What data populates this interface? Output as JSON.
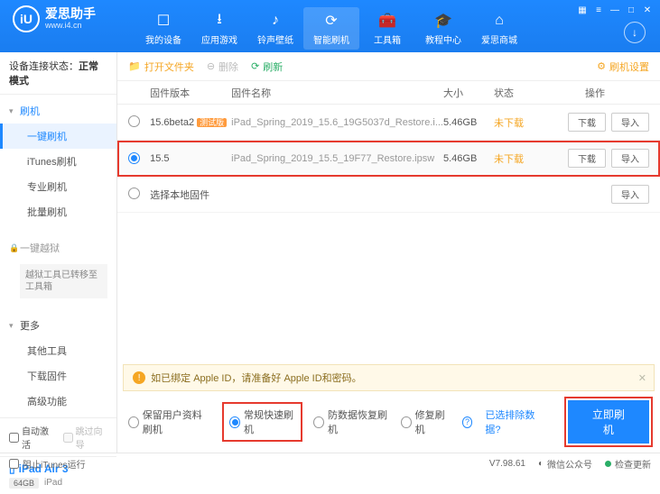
{
  "brand": {
    "title": "爱思助手",
    "sub": "www.i4.cn",
    "logo_letter": "iU"
  },
  "titlebar": {
    "menu": "▦",
    "tray": "≡",
    "min": "—",
    "max": "□",
    "close": "✕"
  },
  "nav": [
    {
      "icon": "☐",
      "label": "我的设备"
    },
    {
      "icon": "⭳",
      "label": "应用游戏"
    },
    {
      "icon": "♪",
      "label": "铃声壁纸"
    },
    {
      "icon": "⟳",
      "label": "智能刷机"
    },
    {
      "icon": "🧰",
      "label": "工具箱"
    },
    {
      "icon": "🎓",
      "label": "教程中心"
    },
    {
      "icon": "⌂",
      "label": "爱思商城"
    }
  ],
  "header_right_icon": "↓",
  "sidebar": {
    "conn_label": "设备连接状态：",
    "conn_value": "正常模式",
    "sections": {
      "flash": {
        "head": "刷机",
        "items": [
          "一键刷机",
          "iTunes刷机",
          "专业刷机",
          "批量刷机"
        ]
      },
      "jailbreak": {
        "head": "一键越狱",
        "note": "越狱工具已转移至工具箱"
      },
      "more": {
        "head": "更多",
        "items": [
          "其他工具",
          "下载固件",
          "高级功能"
        ]
      }
    },
    "checks": {
      "auto_activate": "自动激活",
      "skip_guide": "跳过向导"
    },
    "device": {
      "name": "iPad Air 3",
      "storage": "64GB",
      "type": "iPad"
    }
  },
  "toolbar": {
    "open_folder": "打开文件夹",
    "delete": "删除",
    "refresh": "刷新",
    "settings": "刷机设置"
  },
  "table": {
    "headers": {
      "ver": "固件版本",
      "name": "固件名称",
      "size": "大小",
      "status": "状态",
      "ops": "操作"
    },
    "rows": [
      {
        "ver": "15.6beta2",
        "beta": "测试版",
        "name": "iPad_Spring_2019_15.6_19G5037d_Restore.i...",
        "size": "5.46GB",
        "status": "未下载",
        "selected": false
      },
      {
        "ver": "15.5",
        "beta": "",
        "name": "iPad_Spring_2019_15.5_19F77_Restore.ipsw",
        "size": "5.46GB",
        "status": "未下载",
        "selected": true
      }
    ],
    "local_row": "选择本地固件",
    "btn_download": "下载",
    "btn_import": "导入"
  },
  "alert": {
    "text": "如已绑定 Apple ID，请准备好 Apple ID和密码。"
  },
  "options": {
    "keep_data": "保留用户资料刷机",
    "normal": "常规快速刷机",
    "anti_recovery": "防数据恢复刷机",
    "repair": "修复刷机",
    "exclude_link": "已选排除数据?",
    "flash_btn": "立即刷机"
  },
  "footer": {
    "block_itunes": "阻止iTunes运行",
    "version": "V7.98.61",
    "wechat": "微信公众号",
    "check_update": "检查更新"
  }
}
